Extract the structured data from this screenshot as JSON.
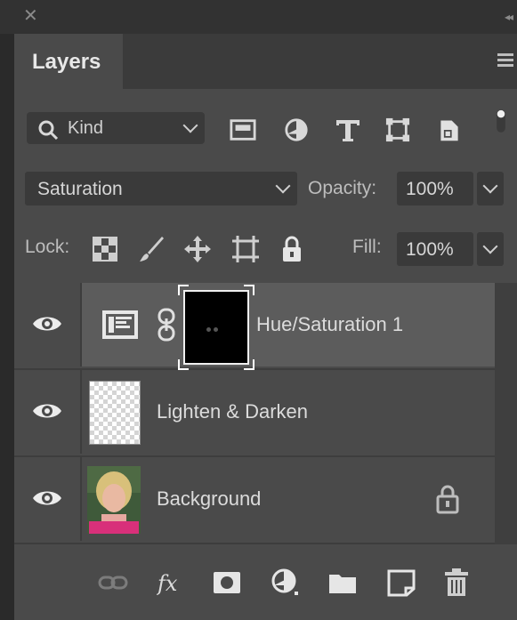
{
  "window": {
    "close_glyph": "✕",
    "collapse_glyph": "◂◂"
  },
  "tabs": [
    {
      "label": "Layers",
      "active": true
    }
  ],
  "filter": {
    "kind_label": "Kind",
    "icons": [
      "pixel-filter-icon",
      "adjustment-filter-icon",
      "type-filter-icon",
      "shape-filter-icon",
      "smart-object-filter-icon",
      "filter-toggle-icon"
    ]
  },
  "blend": {
    "mode": "Saturation",
    "opacity_label": "Opacity:",
    "opacity_value": "100%"
  },
  "lock": {
    "label": "Lock:",
    "icons": [
      "lock-transparent-icon",
      "lock-image-icon",
      "lock-position-icon",
      "lock-artboard-icon",
      "lock-all-icon"
    ],
    "fill_label": "Fill:",
    "fill_value": "100%"
  },
  "layers": [
    {
      "name": "Hue/Saturation 1",
      "type": "adjustment",
      "visible": true,
      "selected": true
    },
    {
      "name": "Lighten & Darken",
      "type": "transparent",
      "visible": true,
      "selected": false
    },
    {
      "name": "Background",
      "type": "image",
      "visible": true,
      "selected": false,
      "locked": true
    }
  ],
  "bottom_icons": [
    "link-layers-icon",
    "layer-style-icon",
    "add-mask-icon",
    "new-adjustment-icon",
    "new-group-icon",
    "new-layer-icon",
    "delete-layer-icon"
  ],
  "colors": {
    "panel_bg": "#4a4a4a",
    "selected_row": "#5c5c5c",
    "field_bg": "#3a3a3a",
    "background_thumb_accent": "#d8307a"
  }
}
